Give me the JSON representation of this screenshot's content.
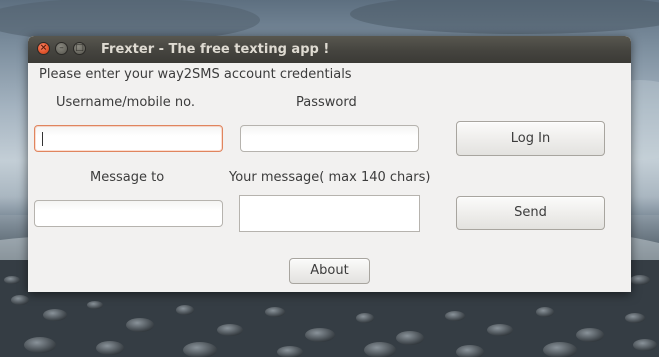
{
  "window": {
    "title": "Frexter - The free texting app !",
    "controls": {
      "close_glyph": "×",
      "minimize_glyph": "–",
      "maximize_glyph": "□"
    }
  },
  "form": {
    "instructions": "Please enter your way2SMS account credentials",
    "username_label": "Username/mobile no.",
    "username_value": "",
    "password_label": "Password",
    "password_value": "",
    "message_to_label": "Message to",
    "message_to_value": "",
    "message_label": "Your message( max 140 chars)",
    "message_value": ""
  },
  "buttons": {
    "login_label": "Log In",
    "send_label": "Send",
    "about_label": "About"
  },
  "colors": {
    "close_button": "#e4572f",
    "titlebar": "#45443f",
    "window_bg": "#f2f1f0",
    "focus_border": "#e0855e"
  }
}
